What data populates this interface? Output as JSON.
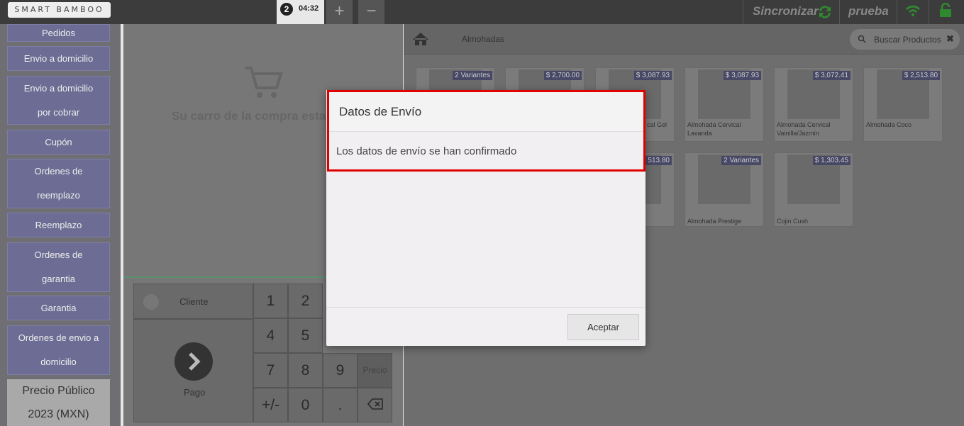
{
  "topbar": {
    "logo": "SMART BAMBOO",
    "order_number": "2",
    "order_time": "04:32",
    "add_label": "+",
    "remove_label": "−",
    "sync_label": "Sincronizar",
    "user_label": "prueba"
  },
  "sidebar": {
    "items": [
      {
        "label": "Pedidos"
      },
      {
        "label": "Envio a domicilio"
      },
      {
        "label": "Envio a domicilio",
        "label2": "por cobrar"
      },
      {
        "label": "Cupón"
      },
      {
        "label": "Ordenes de",
        "label2": "reemplazo"
      },
      {
        "label": "Reemplazo"
      },
      {
        "label": "Ordenes de",
        "label2": "garantia"
      },
      {
        "label": "Garantia"
      },
      {
        "label": "Ordenes de envio a",
        "label2": "domicilio"
      }
    ],
    "pricelist_line1": "Precio Público",
    "pricelist_line2": "2023 (MXN)"
  },
  "cart": {
    "empty_message": "Su carro de la compra esta v"
  },
  "payment": {
    "client_label": "Cliente",
    "pay_label": "Pago",
    "keys": [
      "1",
      "2",
      "4",
      "5",
      "7",
      "8",
      "9",
      "Precio",
      "+/-",
      "0",
      "."
    ]
  },
  "products": {
    "breadcrumb": "Almohadas",
    "search_placeholder": "Buscar Productos",
    "items": [
      {
        "price": "2 Variantes",
        "name": ""
      },
      {
        "price": "$ 2,700.00",
        "name": ""
      },
      {
        "price": "$ 3,087.93",
        "name": "cal Gel"
      },
      {
        "price": "$ 3,087.93",
        "name": "Almohada Cervical Lavanda"
      },
      {
        "price": "$ 3,072.41",
        "name": "Almohada Cervical Vainilla/Jazmín"
      },
      {
        "price": "$ 2,513.80",
        "name": "Almohada Coco"
      },
      {
        "price": "513.80",
        "name": ""
      },
      {
        "price": "2 Variantes",
        "name": "Almohada Prestige"
      },
      {
        "price": "$ 1,303.45",
        "name": "Cojin Cush"
      }
    ]
  },
  "modal": {
    "title": "Datos de Envío",
    "message": "Los datos de envío se han confirmado",
    "button": "Aceptar"
  }
}
